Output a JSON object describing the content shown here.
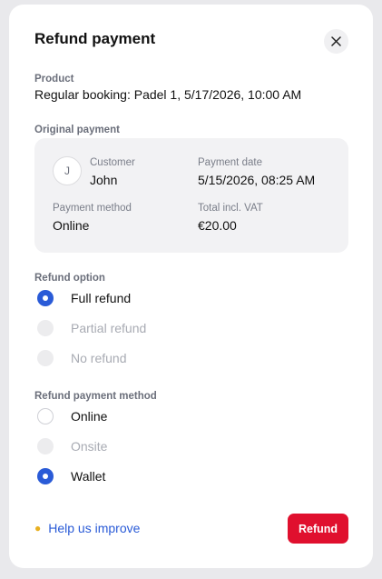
{
  "dialog": {
    "title": "Refund payment"
  },
  "product": {
    "label": "Product",
    "value": "Regular booking: Padel 1, 5/17/2026, 10:00 AM"
  },
  "original_payment": {
    "label": "Original payment",
    "avatar_initial": "J",
    "customer_label": "Customer",
    "customer_value": "John",
    "payment_date_label": "Payment date",
    "payment_date_value": "5/15/2026, 08:25 AM",
    "payment_method_label": "Payment method",
    "payment_method_value": "Online",
    "total_label": "Total incl. VAT",
    "total_value": "€20.00"
  },
  "refund_option": {
    "label": "Refund option",
    "options": [
      {
        "label": "Full refund",
        "state": "selected"
      },
      {
        "label": "Partial refund",
        "state": "disabled"
      },
      {
        "label": "No refund",
        "state": "disabled"
      }
    ]
  },
  "refund_payment_method": {
    "label": "Refund payment method",
    "options": [
      {
        "label": "Online",
        "state": "unselected"
      },
      {
        "label": "Onsite",
        "state": "disabled"
      },
      {
        "label": "Wallet",
        "state": "selected"
      }
    ]
  },
  "footer": {
    "help_icon": "lightbulb-icon",
    "help_link": "Help us improve",
    "refund_button": "Refund"
  },
  "colors": {
    "accent": "#2a5bd7",
    "primary_button": "#e0102e",
    "card_background": "#f2f2f4"
  }
}
